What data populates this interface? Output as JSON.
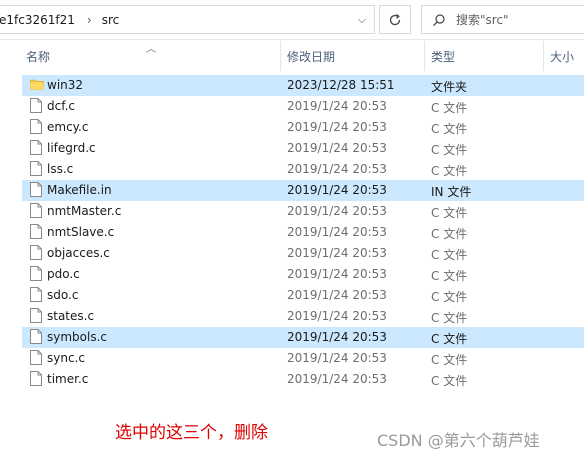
{
  "address_bar": {
    "path_segment": "e1fc3261f21",
    "current_folder": "src"
  },
  "search": {
    "placeholder": "搜索\"src\""
  },
  "columns": {
    "name": "名称",
    "date": "修改日期",
    "type": "类型",
    "size": "大小"
  },
  "files": [
    {
      "name": "win32",
      "date": "2023/12/28 15:51",
      "type": "文件夹",
      "icon": "folder-icon",
      "selected": true
    },
    {
      "name": "dcf.c",
      "date": "2019/1/24 20:53",
      "type": "C 文件",
      "icon": "file-icon",
      "selected": false
    },
    {
      "name": "emcy.c",
      "date": "2019/1/24 20:53",
      "type": "C 文件",
      "icon": "file-icon",
      "selected": false
    },
    {
      "name": "lifegrd.c",
      "date": "2019/1/24 20:53",
      "type": "C 文件",
      "icon": "file-icon",
      "selected": false
    },
    {
      "name": "lss.c",
      "date": "2019/1/24 20:53",
      "type": "C 文件",
      "icon": "file-icon",
      "selected": false
    },
    {
      "name": "Makefile.in",
      "date": "2019/1/24 20:53",
      "type": "IN 文件",
      "icon": "file-icon",
      "selected": true
    },
    {
      "name": "nmtMaster.c",
      "date": "2019/1/24 20:53",
      "type": "C 文件",
      "icon": "file-icon",
      "selected": false
    },
    {
      "name": "nmtSlave.c",
      "date": "2019/1/24 20:53",
      "type": "C 文件",
      "icon": "file-icon",
      "selected": false
    },
    {
      "name": "objacces.c",
      "date": "2019/1/24 20:53",
      "type": "C 文件",
      "icon": "file-icon",
      "selected": false
    },
    {
      "name": "pdo.c",
      "date": "2019/1/24 20:53",
      "type": "C 文件",
      "icon": "file-icon",
      "selected": false
    },
    {
      "name": "sdo.c",
      "date": "2019/1/24 20:53",
      "type": "C 文件",
      "icon": "file-icon",
      "selected": false
    },
    {
      "name": "states.c",
      "date": "2019/1/24 20:53",
      "type": "C 文件",
      "icon": "file-icon",
      "selected": false
    },
    {
      "name": "symbols.c",
      "date": "2019/1/24 20:53",
      "type": "C 文件",
      "icon": "file-icon",
      "selected": true
    },
    {
      "name": "sync.c",
      "date": "2019/1/24 20:53",
      "type": "C 文件",
      "icon": "file-icon",
      "selected": false
    },
    {
      "name": "timer.c",
      "date": "2019/1/24 20:53",
      "type": "C 文件",
      "icon": "file-icon",
      "selected": false
    }
  ],
  "annotation": "选中的这三个，删除",
  "watermark": "CSDN @第六个葫芦娃",
  "colors": {
    "selection": "#cce8ff",
    "annotation": "#e00000",
    "folder": "#f3c445"
  }
}
